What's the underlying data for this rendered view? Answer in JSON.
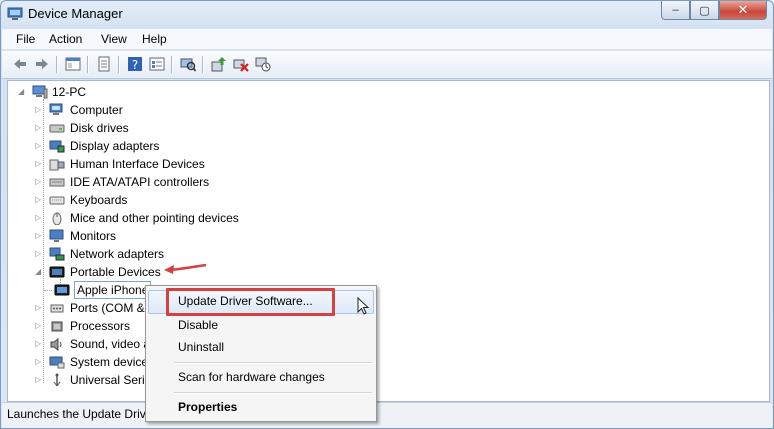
{
  "window": {
    "title": "Device Manager",
    "minimize": "–",
    "maximize": "▢",
    "close": "✕"
  },
  "menu": [
    "File",
    "Action",
    "View",
    "Help"
  ],
  "tree": {
    "root": "12-PC",
    "items": [
      {
        "label": "Computer",
        "icon": "computer-icon"
      },
      {
        "label": "Disk drives",
        "icon": "disk-drive-icon"
      },
      {
        "label": "Display adapters",
        "icon": "display-adapter-icon"
      },
      {
        "label": "Human Interface Devices",
        "icon": "hid-icon"
      },
      {
        "label": "IDE ATA/ATAPI controllers",
        "icon": "ide-controller-icon"
      },
      {
        "label": "Keyboards",
        "icon": "keyboard-icon"
      },
      {
        "label": "Mice and other pointing devices",
        "icon": "mouse-icon"
      },
      {
        "label": "Monitors",
        "icon": "monitor-icon"
      },
      {
        "label": "Network adapters",
        "icon": "network-adapter-icon"
      },
      {
        "label": "Portable Devices",
        "icon": "portable-device-icon"
      },
      {
        "label": "Apple iPhone",
        "icon": "phone-icon"
      },
      {
        "label": "Ports (COM &",
        "icon": "port-icon"
      },
      {
        "label": "Processors",
        "icon": "processor-icon"
      },
      {
        "label": "Sound, video a",
        "icon": "sound-icon"
      },
      {
        "label": "System device",
        "icon": "system-device-icon"
      },
      {
        "label": "Universal Seria",
        "icon": "usb-icon"
      }
    ]
  },
  "context_menu": {
    "items": [
      "Update Driver Software...",
      "Disable",
      "Uninstall",
      "Scan for hardware changes",
      "Properties"
    ]
  },
  "status": "Launches the Update Driv",
  "colors": {
    "highlight_box": "#d64040",
    "selection_border": "#7da2ce"
  }
}
